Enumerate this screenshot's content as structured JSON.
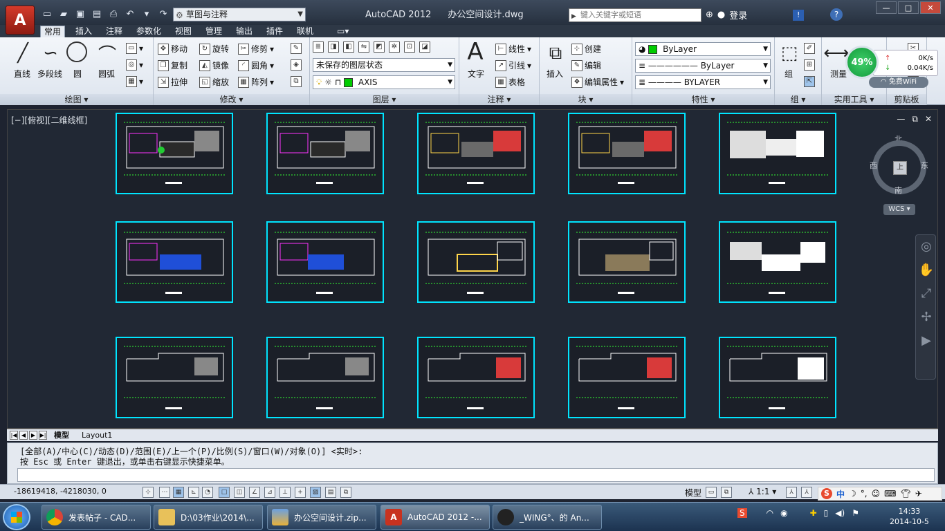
{
  "title_bar": {
    "app_logo": "A",
    "workspace": "草图与注释",
    "app_name": "AutoCAD 2012",
    "file_name": "办公空间设计.dwg",
    "search_placeholder": "键入关键字或短语",
    "login": "登录",
    "help": "?"
  },
  "ribbon_tabs": [
    "常用",
    "插入",
    "注释",
    "参数化",
    "视图",
    "管理",
    "输出",
    "插件",
    "联机"
  ],
  "panels": {
    "draw": {
      "title": "绘图",
      "line": "直线",
      "polyline": "多段线",
      "circle": "圆",
      "arc": "圆弧"
    },
    "modify": {
      "title": "修改",
      "move": "移动",
      "rotate": "旋转",
      "trim": "修剪",
      "copy": "复制",
      "mirror": "镜像",
      "fillet": "圆角",
      "stretch": "拉伸",
      "scale": "缩放",
      "array": "阵列"
    },
    "layers": {
      "title": "图层",
      "layer_state": "未保存的图层状态",
      "current_layer": "AXIS",
      "layer_color": "#00cc00"
    },
    "annotation": {
      "title": "注释",
      "text": "文字",
      "linear": "线性",
      "leader": "引线",
      "table": "表格"
    },
    "block": {
      "title": "块",
      "insert": "插入",
      "create": "创建",
      "edit": "编辑",
      "edit_attributes": "编辑属性"
    },
    "properties": {
      "title": "特性",
      "color": "ByLayer",
      "color_swatch": "#00cc00",
      "linetype": "ByLayer",
      "lineweight": "BYLAYER"
    },
    "groups": {
      "title": "组",
      "group": "组"
    },
    "utilities": {
      "title": "实用工具",
      "measure": "测量"
    },
    "clipboard": {
      "title": "剪贴板"
    }
  },
  "network_widget": {
    "percent": "49%",
    "upload": "0K/s",
    "download": "0.04K/s",
    "wifi": "免费WiFi"
  },
  "viewport": {
    "label": "[−][俯视][二维线框]",
    "compass_n": "北",
    "compass_s": "南",
    "compass_e": "东",
    "compass_w": "西",
    "viewcube_face": "上",
    "wcs": "WCS"
  },
  "layout_tabs": [
    "模型",
    "Layout1"
  ],
  "command": {
    "line1": "[全部(A)/中心(C)/动态(D)/范围(E)/上一个(P)/比例(S)/窗口(W)/对象(O)] <实时>:",
    "line2": "按 Esc 或 Enter 键退出，或单击右键显示快捷菜单。"
  },
  "status_bar": {
    "coords": "-18619418,  -4218030,  0",
    "model": "模型",
    "scale": "1:1"
  },
  "taskbar": {
    "tasks": [
      {
        "label": "发表帖子 - CAD...",
        "icon": "chrome-icon"
      },
      {
        "label": "D:\\03作业\\2014\\...",
        "icon": "folder-icon"
      },
      {
        "label": "办公空间设计.zip...",
        "icon": "archive-icon"
      },
      {
        "label": "AutoCAD 2012 -...",
        "icon": "autocad-icon"
      },
      {
        "label": "_WING°、的 An...",
        "icon": "qq-icon"
      }
    ],
    "time": "14:33",
    "date": "2014-10-5"
  },
  "ime": {
    "mode": "中"
  },
  "colors": {
    "sheet_border": "#00e5ff",
    "canvas_bg": "#212834"
  }
}
